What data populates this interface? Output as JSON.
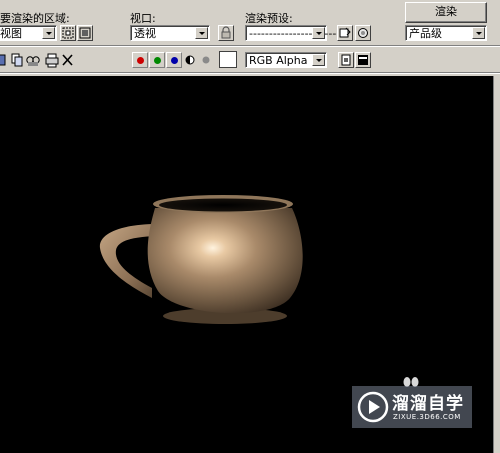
{
  "toolbar": {
    "region_label": "要渲染的区域:",
    "region_value": "视图",
    "viewport_label": "视口:",
    "viewport_value": "透视",
    "preset_label": "渲染预设:",
    "preset_value": "-------------------------",
    "render_button": "渲染",
    "quality_value": "产品级",
    "channel_value": "RGB Alpha"
  },
  "channels": [
    {
      "name": "red",
      "color": "#cc0000"
    },
    {
      "name": "green",
      "color": "#008800"
    },
    {
      "name": "blue",
      "color": "#0000aa"
    }
  ],
  "watermark": {
    "brand": "溜溜自学",
    "url": "ZIXUE.3D66.COM"
  }
}
